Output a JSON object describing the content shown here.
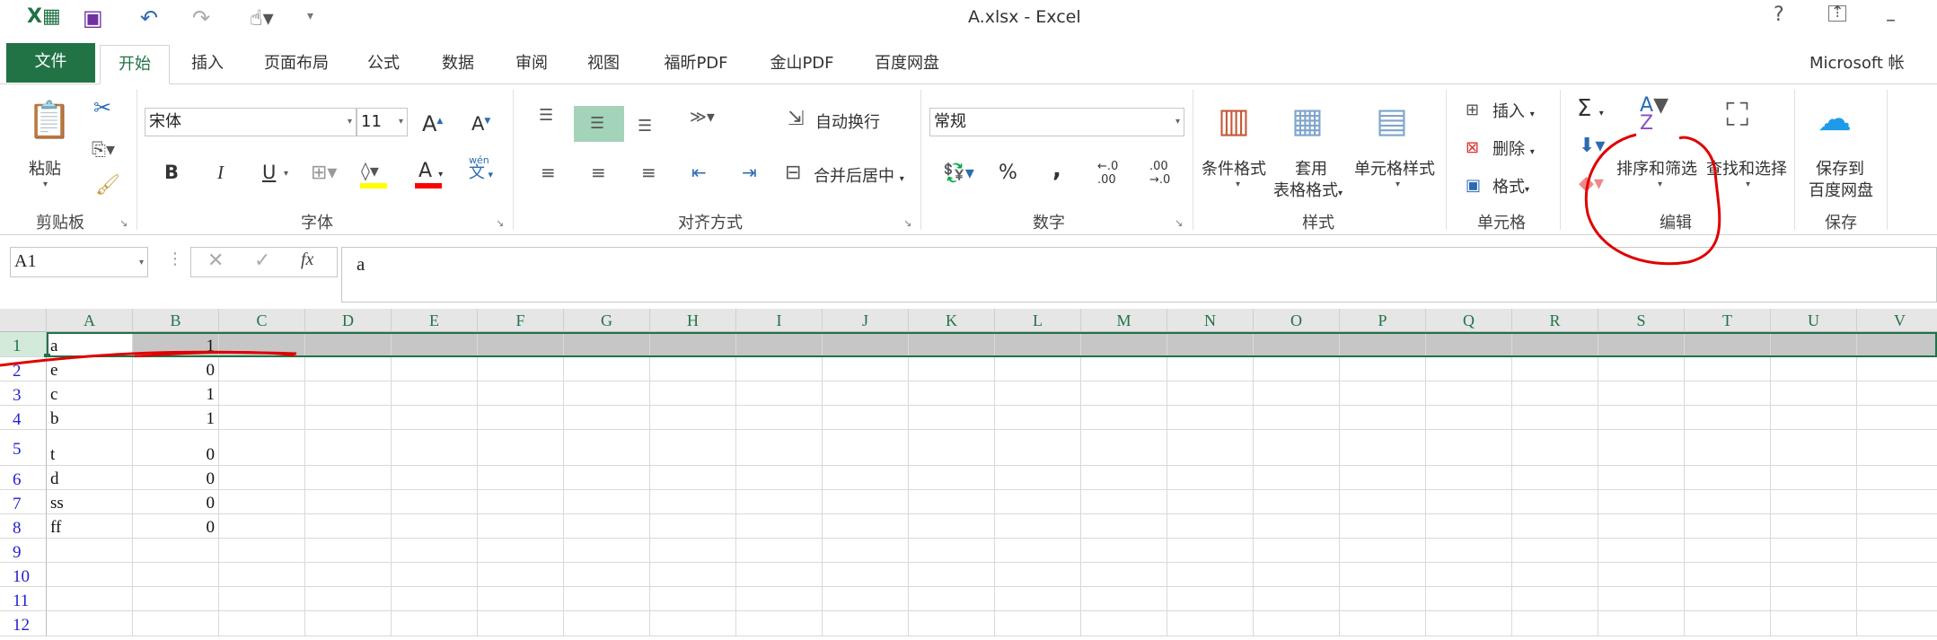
{
  "window": {
    "title": "A.xlsx - Excel",
    "help": "?",
    "account": "Microsoft 帐"
  },
  "quick_access": [
    "excel-logo-icon",
    "save-icon",
    "undo-icon",
    "redo-icon",
    "touch-mode-icon",
    "customize-icon"
  ],
  "tabs": [
    {
      "label": "文件"
    },
    {
      "label": "开始"
    },
    {
      "label": "插入"
    },
    {
      "label": "页面布局"
    },
    {
      "label": "公式"
    },
    {
      "label": "数据"
    },
    {
      "label": "审阅"
    },
    {
      "label": "视图"
    },
    {
      "label": "福昕PDF"
    },
    {
      "label": "金山PDF"
    },
    {
      "label": "百度网盘"
    }
  ],
  "active_tab": "开始",
  "ribbon": {
    "clipboard": {
      "label": "剪贴板",
      "paste": "粘贴"
    },
    "font": {
      "label": "字体",
      "name": "宋体",
      "size": "11",
      "bold": "B",
      "italic": "I",
      "underline": "U",
      "font_color": "A",
      "phonetic": "wén",
      "phonetic_char": "文",
      "grow": "A",
      "shrink": "A",
      "highlight_color": "#ffff00",
      "text_color": "#ff0000"
    },
    "alignment": {
      "label": "对齐方式",
      "wrap": "自动换行",
      "merge": "合并后居中"
    },
    "number": {
      "label": "数字",
      "format": "常规",
      "percent": "%",
      "comma": ",",
      "inc": "←.0\n.00",
      "dec": ".00\n→.0"
    },
    "styles": {
      "label": "样式",
      "conditional": "条件格式",
      "table_l1": "套用",
      "table_l2": "表格格式",
      "cell_styles": "单元格样式"
    },
    "cells": {
      "label": "单元格",
      "insert": "插入",
      "delete": "删除",
      "format": "格式"
    },
    "editing": {
      "label": "编辑",
      "sum": "Σ",
      "sort_filter": "排序和筛选",
      "find_select": "查找和选择"
    },
    "save": {
      "label": "保存",
      "baidu_l1": "保存到",
      "baidu_l2": "百度网盘"
    }
  },
  "formula_bar": {
    "name_box": "A1",
    "value": "a",
    "cancel": "✕",
    "enter": "✓",
    "fx": "fx"
  },
  "columns": [
    "A",
    "B",
    "C",
    "D",
    "E",
    "F",
    "G",
    "H",
    "I",
    "J",
    "K",
    "L",
    "M",
    "N",
    "O",
    "P",
    "Q",
    "R",
    "S",
    "T",
    "U",
    "V"
  ],
  "rows": [
    {
      "n": "1",
      "a": "a",
      "b": "1"
    },
    {
      "n": "2",
      "a": "e",
      "b": "0"
    },
    {
      "n": "3",
      "a": "c",
      "b": "1"
    },
    {
      "n": "4",
      "a": "b",
      "b": "1"
    },
    {
      "n": "5",
      "a": "t",
      "b": "0"
    },
    {
      "n": "6",
      "a": "d",
      "b": "0"
    },
    {
      "n": "7",
      "a": "ss",
      "b": "0"
    },
    {
      "n": "8",
      "a": "ff",
      "b": "0"
    },
    {
      "n": "9",
      "a": "",
      "b": ""
    },
    {
      "n": "10",
      "a": "",
      "b": ""
    },
    {
      "n": "11",
      "a": "",
      "b": ""
    },
    {
      "n": "12",
      "a": "",
      "b": ""
    }
  ],
  "selection": {
    "active_cell": "A1",
    "selected_row": "1"
  },
  "colors": {
    "accent": "#217346",
    "selected_row_bg": "#c6c6c6",
    "annotation": "#e00000"
  }
}
